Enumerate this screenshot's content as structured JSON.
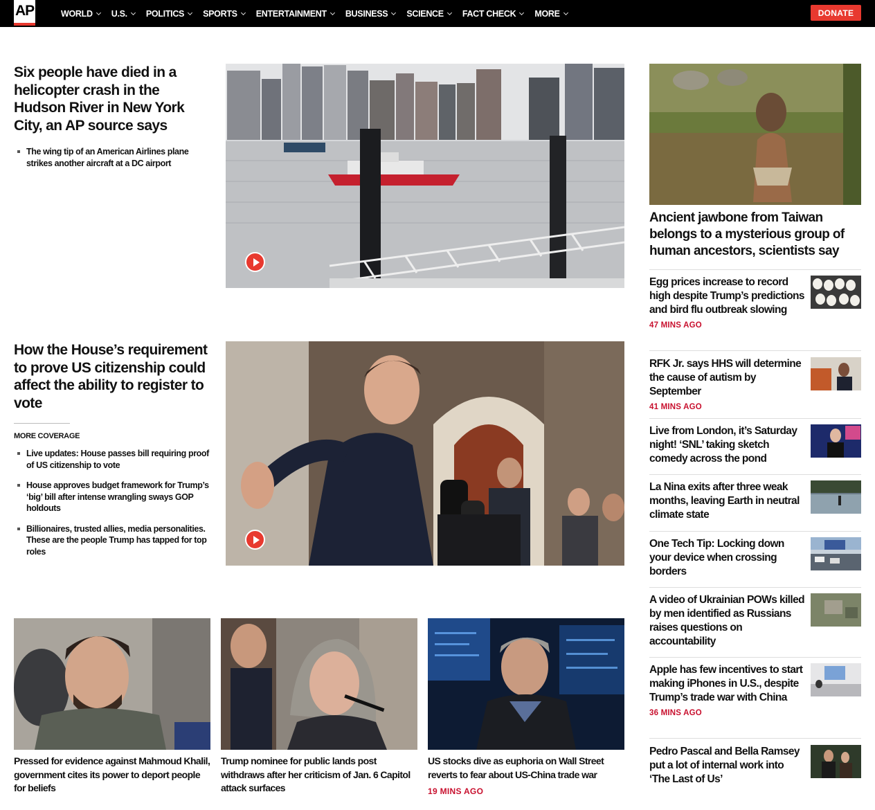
{
  "nav": {
    "logo": "AP",
    "items": [
      "WORLD",
      "U.S.",
      "POLITICS",
      "SPORTS",
      "ENTERTAINMENT",
      "BUSINESS",
      "SCIENCE",
      "FACT CHECK",
      "MORE"
    ],
    "donate": "DONATE"
  },
  "lead1": {
    "headline": "Six people have died in a helicopter crash in the Hudson River in New York City, an AP source says",
    "related": [
      "The wing tip of an American Airlines plane strikes another aircraft at a DC airport"
    ]
  },
  "lead2": {
    "headline": "How the House’s requirement to prove US citizenship could affect the ability to register to vote",
    "more_coverage": "MORE COVERAGE",
    "related": [
      "Live updates: House passes bill requiring proof of US citizenship to vote",
      "House approves budget framework for Trump’s ‘big’ bill after intense wrangling sways GOP holdouts",
      "Billionaires, trusted allies, media personalities. These are the people Trump has tapped for top roles"
    ]
  },
  "cards": [
    {
      "title": "Pressed for evidence against Mahmoud Khalil, government cites its power to deport people for beliefs",
      "time": ""
    },
    {
      "title": "Trump nominee for public lands post withdraws after her criticism of Jan. 6 Capitol attack surfaces",
      "time": ""
    },
    {
      "title": "US stocks dive as euphoria on Wall Street reverts to fear about US-China trade war",
      "time": "19 MINS AGO"
    }
  ],
  "rail": {
    "feature_title": "Ancient jawbone from Taiwan belongs to a mysterious group of human ancestors, scientists say",
    "items": [
      {
        "title": "Egg prices increase to record high despite Trump’s predictions and bird flu outbreak slowing",
        "time": "47 MINS AGO"
      },
      {
        "title": "RFK Jr. says HHS will determine the cause of autism by September",
        "time": "41 MINS AGO"
      },
      {
        "title": "Live from London, it’s Saturday night! ‘SNL’ taking sketch comedy across the pond",
        "time": ""
      },
      {
        "title": "La Nina exits after three weak months, leaving Earth in neutral climate state",
        "time": ""
      },
      {
        "title": "One Tech Tip: Locking down your device when crossing borders",
        "time": ""
      },
      {
        "title": "A video of Ukrainian POWs killed by men identified as Russians raises questions on accountability",
        "time": ""
      },
      {
        "title": "Apple has few incentives to start making iPhones in U.S., despite Trump’s trade war with China",
        "time": "36 MINS AGO"
      },
      {
        "title": "Pedro Pascal and Bella Ramsey put a lot of internal work into ‘The Last of Us’",
        "time": ""
      }
    ]
  },
  "colors": {
    "accent": "#e8392f",
    "time_red": "#c8102e",
    "nav_bg": "#000000"
  }
}
